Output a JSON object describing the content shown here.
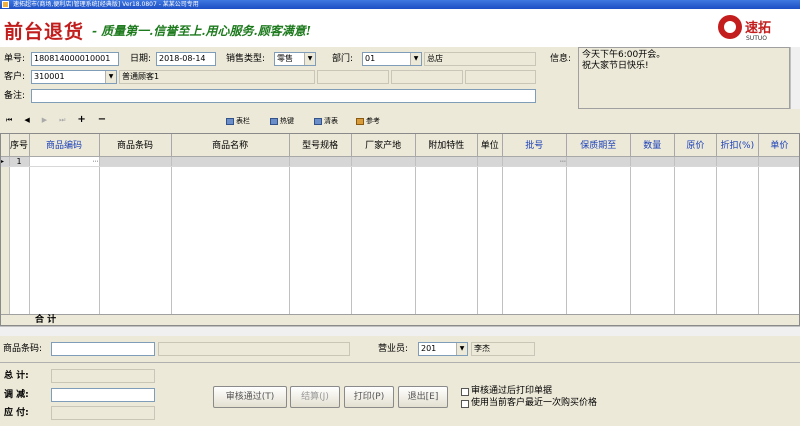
{
  "window": {
    "title": "速拓超市(商场,便利店)管理系统[经典版] Ver18.0807 - 某某公司专用"
  },
  "banner": {
    "title": "前台退货",
    "slogan": "- 质量第一.信誉至上.用心服务.顾客满意!",
    "logo_text": "速拓",
    "logo_sub": "SUTUO"
  },
  "form": {
    "order_no_label": "单号:",
    "order_no": "180814000010001",
    "date_label": "日期:",
    "date": "2018-08-14",
    "sale_type_label": "销售类型:",
    "sale_type": "零售",
    "dept_label": "部门:",
    "dept_code": "01",
    "dept_name": "总店",
    "customer_label": "客户:",
    "customer_code": "310001",
    "customer_name": "普通顾客1",
    "remark_label": "备注:",
    "remark": ""
  },
  "info": {
    "label": "信息:",
    "line1": "今天下午6:00开会。",
    "line2": "祝大家节日快乐!"
  },
  "toolbar": {
    "nav_first": "⏮",
    "nav_prev": "◀",
    "nav_next": "▶",
    "nav_last": "⏭",
    "add": "+",
    "remove": "−",
    "columns_label": "表栏",
    "hotkey_label": "热键",
    "clear_label": "清表",
    "ref_label": "参考"
  },
  "grid": {
    "columns": [
      "序号",
      "商品编码",
      "商品条码",
      "商品名称",
      "型号规格",
      "厂家产地",
      "附加特性",
      "单位",
      "批号",
      "保质期至",
      "数量",
      "原价",
      "折扣(%)",
      "单价"
    ],
    "row1_no": "1",
    "sum_label": "合  计"
  },
  "lower": {
    "barcode_label": "商品条码:",
    "barcode": "",
    "clerk_label": "营业员:",
    "clerk_code": "201",
    "clerk_name": "李杰"
  },
  "totals": {
    "total_label": "总  计:",
    "adjust_label": "调  减:",
    "due_label": "应  付:"
  },
  "buttons": {
    "approve": "审核通过(T)",
    "settle": "结算(J)",
    "print": "打印(P)",
    "exit": "退出[E]"
  },
  "options": {
    "print_after_approve": "审核通过后打印单据",
    "use_last_price": "使用当前客户最近一次购买价格"
  }
}
